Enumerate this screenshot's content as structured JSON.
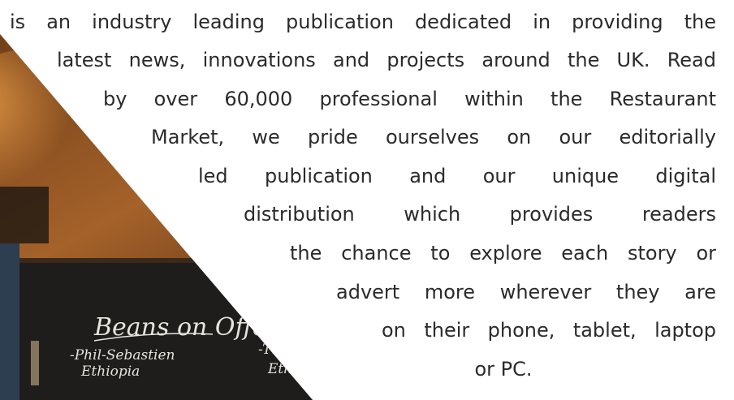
{
  "article": {
    "lines": [
      "is an industry leading publication dedicated in providing the",
      "latest news, innovations and projects around the UK. Read",
      "by over 60,000 professional within the Restaurant",
      "Market, we pride ourselves on our editorially",
      "led publication and our unique digital",
      "distribution which provides readers",
      "the chance to explore each story or",
      "advert more wherever they are",
      "on their phone, tablet, laptop",
      "or PC."
    ]
  },
  "chalkboard": {
    "heading": "Beans on Offer",
    "item_1": "-Phil-Sebastien",
    "item_1_origin": "Ethiopia",
    "item_2": "-Transcend",
    "item_2_origin": "Ethiopia"
  }
}
